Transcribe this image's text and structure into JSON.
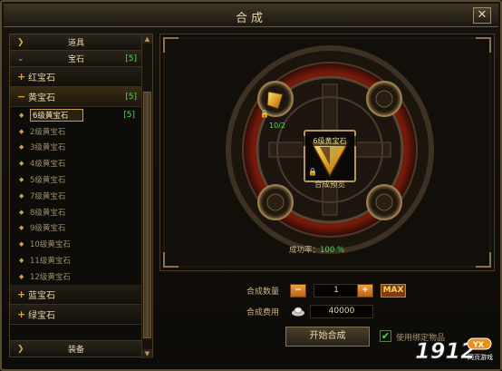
{
  "window": {
    "title": "合成"
  },
  "left": {
    "header": "道具",
    "categories": [
      {
        "label": "宝石",
        "count": "[5]"
      },
      {
        "label": "红宝石"
      },
      {
        "label": "黄宝石",
        "count": "[5]"
      }
    ],
    "items": [
      {
        "label": "6级黄宝石",
        "count": "[5]"
      },
      {
        "label": "2级黄宝石"
      },
      {
        "label": "3级黄宝石"
      },
      {
        "label": "4级黄宝石"
      },
      {
        "label": "5级黄宝石"
      },
      {
        "label": "7级黄宝石"
      },
      {
        "label": "8级黄宝石"
      },
      {
        "label": "9级黄宝石"
      },
      {
        "label": "10级黄宝石"
      },
      {
        "label": "11级黄宝石"
      },
      {
        "label": "12级黄宝石"
      }
    ],
    "more_categories": [
      {
        "label": "蓝宝石"
      },
      {
        "label": "绿宝石"
      }
    ],
    "footer": "装备"
  },
  "synthesis": {
    "gem_name": "6级黄宝石",
    "material_count": "10/2",
    "center_label": "合成预览",
    "success_rate_label": "成功率：",
    "success_rate_value": "100 %"
  },
  "controls": {
    "quantity_label": "合成数量",
    "quantity_value": "1",
    "max_label": "MAX",
    "cost_label": "合成费用",
    "cost_value": "40000",
    "start_button": "开始合成",
    "checkbox_label": "使用绑定物品"
  },
  "watermark": {
    "text": "1912",
    "badge": "YX",
    "sub": "网页游戏"
  },
  "colors": {
    "gold": "#d2a95a",
    "green_text": "#3fe04a",
    "orange_btn": "#e2902e"
  }
}
